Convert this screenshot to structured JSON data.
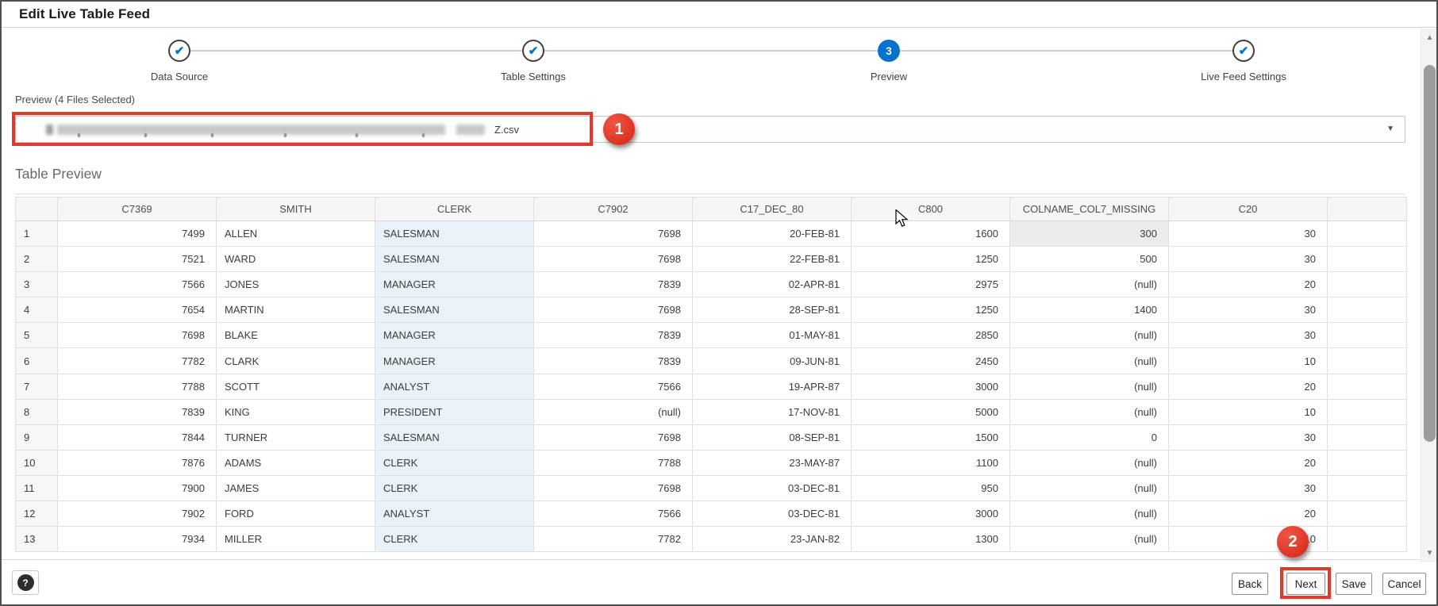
{
  "window": {
    "title": "Edit Live Table Feed"
  },
  "stepper": {
    "steps": [
      {
        "label": "Data Source",
        "state": "complete"
      },
      {
        "label": "Table Settings",
        "state": "complete"
      },
      {
        "label": "Preview",
        "state": "current",
        "number": "3"
      },
      {
        "label": "Live Feed Settings",
        "state": "complete"
      }
    ]
  },
  "preview": {
    "label": "Preview (4 Files Selected)",
    "selected_file_visible_text": "Z.csv",
    "file_redacted": true
  },
  "table_preview": {
    "heading": "Table Preview",
    "columns": [
      "C7369",
      "SMITH",
      "CLERK",
      "C7902",
      "C17_DEC_80",
      "C800",
      "COLNAME_COL7_MISSING",
      "C20"
    ],
    "rows": [
      {
        "num": "1",
        "cells": [
          "7499",
          "ALLEN",
          "SALESMAN",
          "7698",
          "20-FEB-81",
          "1600",
          "300",
          "30"
        ]
      },
      {
        "num": "2",
        "cells": [
          "7521",
          "WARD",
          "SALESMAN",
          "7698",
          "22-FEB-81",
          "1250",
          "500",
          "30"
        ]
      },
      {
        "num": "3",
        "cells": [
          "7566",
          "JONES",
          "MANAGER",
          "7839",
          "02-APR-81",
          "2975",
          "(null)",
          "20"
        ]
      },
      {
        "num": "4",
        "cells": [
          "7654",
          "MARTIN",
          "SALESMAN",
          "7698",
          "28-SEP-81",
          "1250",
          "1400",
          "30"
        ]
      },
      {
        "num": "5",
        "cells": [
          "7698",
          "BLAKE",
          "MANAGER",
          "7839",
          "01-MAY-81",
          "2850",
          "(null)",
          "30"
        ]
      },
      {
        "num": "6",
        "cells": [
          "7782",
          "CLARK",
          "MANAGER",
          "7839",
          "09-JUN-81",
          "2450",
          "(null)",
          "10"
        ]
      },
      {
        "num": "7",
        "cells": [
          "7788",
          "SCOTT",
          "ANALYST",
          "7566",
          "19-APR-87",
          "3000",
          "(null)",
          "20"
        ]
      },
      {
        "num": "8",
        "cells": [
          "7839",
          "KING",
          "PRESIDENT",
          "(null)",
          "17-NOV-81",
          "5000",
          "(null)",
          "10"
        ]
      },
      {
        "num": "9",
        "cells": [
          "7844",
          "TURNER",
          "SALESMAN",
          "7698",
          "08-SEP-81",
          "1500",
          "0",
          "30"
        ]
      },
      {
        "num": "10",
        "cells": [
          "7876",
          "ADAMS",
          "CLERK",
          "7788",
          "23-MAY-87",
          "1100",
          "(null)",
          "20"
        ]
      },
      {
        "num": "11",
        "cells": [
          "7900",
          "JAMES",
          "CLERK",
          "7698",
          "03-DEC-81",
          "950",
          "(null)",
          "30"
        ]
      },
      {
        "num": "12",
        "cells": [
          "7902",
          "FORD",
          "ANALYST",
          "7566",
          "03-DEC-81",
          "3000",
          "(null)",
          "20"
        ]
      },
      {
        "num": "13",
        "cells": [
          "7934",
          "MILLER",
          "CLERK",
          "7782",
          "23-JAN-82",
          "1300",
          "(null)",
          "10"
        ]
      }
    ]
  },
  "annotations": {
    "badge1": "1",
    "badge2": "2",
    "accent_color": "#e3392b"
  },
  "footer": {
    "help": "?",
    "back": "Back",
    "next": "Next",
    "save": "Save",
    "cancel": "Cancel"
  },
  "colors": {
    "step_blue": "#0572ce",
    "highlight_column": "#e9f2f9"
  }
}
